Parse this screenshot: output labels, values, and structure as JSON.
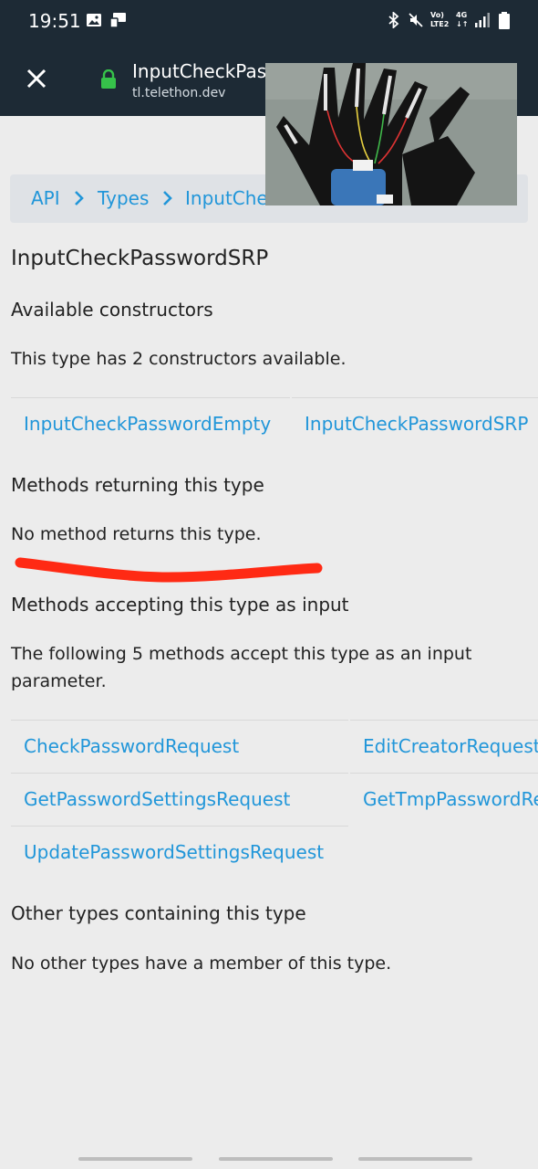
{
  "status_bar": {
    "time": "19:51",
    "net_label_1": "Vo)",
    "net_label_2": "LTE2",
    "net_label_3": "4G"
  },
  "toolbar": {
    "title": "InputCheckPasswordSRP",
    "url": "tl.telethon.dev"
  },
  "breadcrumb": [
    "API",
    "Types",
    "InputCheckPasswordSRP"
  ],
  "page": {
    "title": "InputCheckPasswordSRP",
    "constructors_heading": "Available constructors",
    "constructors_text": "This type has 2 constructors available.",
    "constructors": [
      "InputCheckPasswordEmpty",
      "InputCheckPasswordSRP"
    ],
    "returning_heading": "Methods returning this type",
    "returning_text": "No method returns this type.",
    "accepting_heading": "Methods accepting this type as input",
    "accepting_text": "The following 5 methods accept this type as an input parameter.",
    "methods": [
      "CheckPasswordRequest",
      "EditCreatorRequest",
      "GetPasswordSettingsRequest",
      "GetTmpPasswordRequest",
      "UpdatePasswordSettingsRequest"
    ],
    "containing_heading": "Other types containing this type",
    "containing_text": "No other types have a member of this type."
  },
  "colors": {
    "link": "#2196d9",
    "annotation": "#ff2a14",
    "bar": "#1d2a35"
  }
}
